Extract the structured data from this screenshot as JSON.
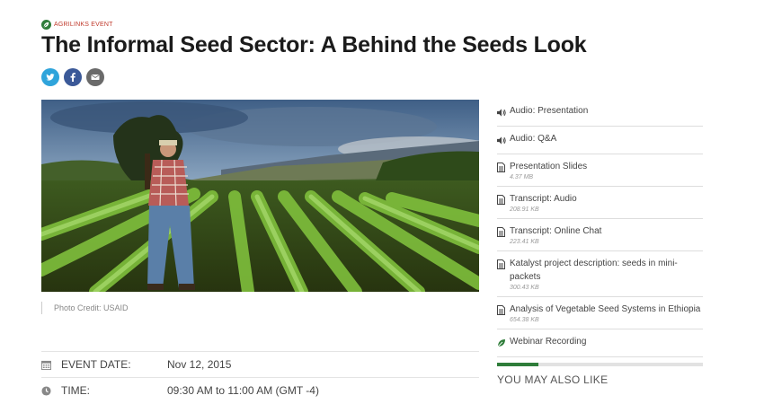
{
  "header": {
    "tag_label": "AGRILINKS EVENT",
    "title": "The Informal Seed Sector: A Behind the Seeds Look"
  },
  "share": {
    "icons": [
      "twitter-icon",
      "facebook-icon",
      "email-icon"
    ],
    "colors": {
      "twitter": "#2fa4db",
      "facebook": "#3b5998",
      "email": "#6a6a6a"
    }
  },
  "photo": {
    "credit": "Photo Credit: USAID"
  },
  "event": {
    "date_label": "EVENT DATE:",
    "date_value": "Nov 12, 2015",
    "time_label": "TIME:",
    "time_value": "09:30 AM to 11:00 AM (GMT -4)"
  },
  "resources": [
    {
      "icon": "audio-icon",
      "title": "Audio: Presentation",
      "size": ""
    },
    {
      "icon": "audio-icon",
      "title": "Audio: Q&A",
      "size": ""
    },
    {
      "icon": "document-icon",
      "title": "Presentation Slides",
      "size": "4.37 MB"
    },
    {
      "icon": "document-icon",
      "title": "Transcript: Audio",
      "size": "208.91 KB"
    },
    {
      "icon": "document-icon",
      "title": "Transcript: Online Chat",
      "size": "223.41 KB"
    },
    {
      "icon": "document-icon",
      "title": "Katalyst project description: seeds in mini-packets",
      "size": "300.43 KB"
    },
    {
      "icon": "document-icon",
      "title": "Analysis of Vegetable Seed Systems in Ethiopia",
      "size": "654.38 KB"
    },
    {
      "icon": "leaf-icon",
      "title": "Webinar Recording",
      "size": ""
    }
  ],
  "sidebar": {
    "progress_fraction": 0.2,
    "accent": "#2f7d3a",
    "also_label": "YOU MAY ALSO LIKE"
  }
}
